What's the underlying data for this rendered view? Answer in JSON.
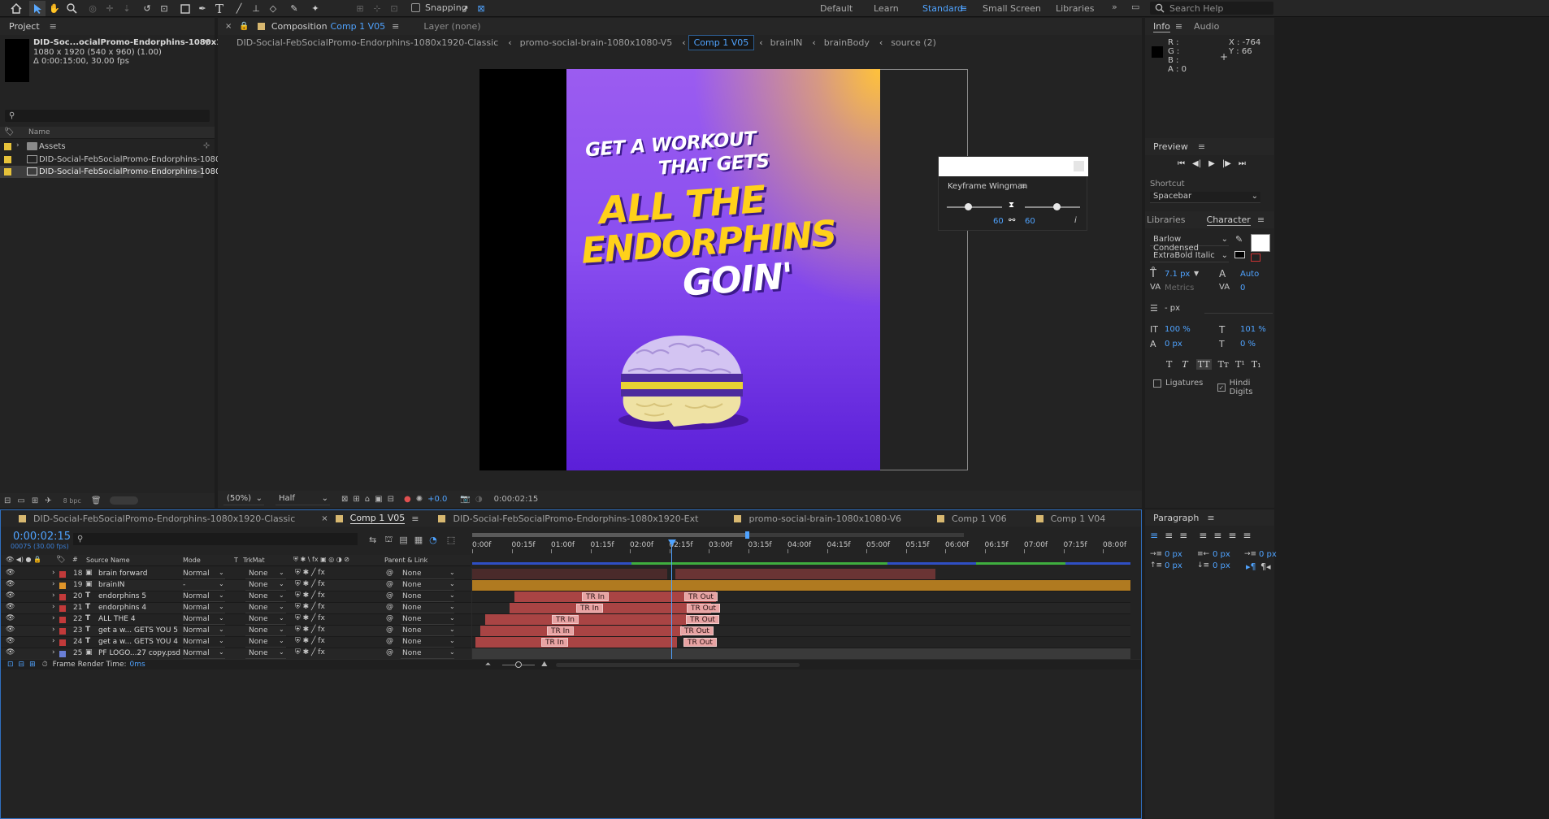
{
  "workspaces": [
    "Default",
    "Learn",
    "Standard",
    "Small Screen",
    "Libraries"
  ],
  "active_workspace": "Standard",
  "toolbar": {
    "snapping": "Snapping",
    "search_placeholder": "Search Help"
  },
  "project": {
    "title": "Project",
    "comp_name": "DID-Soc...ocialPromo-Endorphins-1080x1920-Ext",
    "comp_size": "1080 x 1920  (540 x 960) (1.00)",
    "comp_duration": "Δ 0:00:15:00, 30.00 fps",
    "name_header": "Name",
    "items": [
      {
        "label": "Assets",
        "type": "folder"
      },
      {
        "label": "DID-Social-FebSocialPromo-Endorphins-1080x192",
        "type": "comp"
      },
      {
        "label": "DID-Social-FebSocialPromo-Endorphins-1080x1",
        "type": "comp",
        "selected": true
      }
    ],
    "bpc": "8 bpc"
  },
  "composition": {
    "prefix": "Composition",
    "name": "Comp 1 V05",
    "layer_tab": "Layer (none)",
    "breadcrumbs": [
      "DID-Social-FebSocialPromo-Endorphins-1080x1920-Classic",
      "promo-social-brain-1080x1080-V5",
      "Comp 1 V05",
      "brainIN",
      "brainBody",
      "source (2)"
    ],
    "active_crumb": "Comp 1 V05"
  },
  "artwork": {
    "line1": "GET A WORKOUT",
    "line2": "THAT GETS",
    "line3": "ALL THE",
    "line4": "ENDORPHINS",
    "line5": "GOIN'",
    "colors": {
      "bg_top": "#ffc23a",
      "bg_mid": "#9b5cf0",
      "bg_bottom": "#5b1fd8",
      "yellow": "#ffd11a",
      "white": "#ffffff"
    }
  },
  "viewer": {
    "zoom": "(50%)",
    "resolution": "Half",
    "exposure": "+0.0",
    "timecode": "0:00:02:15"
  },
  "keyframe_wingman": {
    "title": "Keyframe Wingman",
    "left_value": "60",
    "right_value": "60",
    "info_icon": "i"
  },
  "info": {
    "tab1": "Info",
    "tab2": "Audio",
    "r": "R :",
    "g": "G :",
    "b": "B :",
    "a": "A : 0",
    "x": "X : -764",
    "y": "Y : 66"
  },
  "preview": {
    "title": "Preview",
    "shortcut_label": "Shortcut",
    "shortcut_value": "Spacebar"
  },
  "character": {
    "tab_libraries": "Libraries",
    "tab_character": "Character",
    "font": "Barlow Condensed",
    "style": "ExtraBold Italic",
    "size": "7.1 px",
    "leading": "Auto",
    "kerning": "Metrics",
    "tracking": "0",
    "stroke": "- px",
    "vscale": "100 %",
    "hscale": "101 %",
    "baseline": "0 px",
    "tsume": "0 %",
    "ligatures": "Ligatures",
    "hindi": "Hindi Digits"
  },
  "paragraph": {
    "title": "Paragraph",
    "i1": "0 px",
    "i2": "0 px",
    "i3": "0 px",
    "i4": "0 px",
    "i5": "0 px"
  },
  "timeline": {
    "tabs": [
      "DID-Social-FebSocialPromo-Endorphins-1080x1920-Classic",
      "Comp 1 V05",
      "DID-Social-FebSocialPromo-Endorphins-1080x1920-Ext",
      "promo-social-brain-1080x1080-V6",
      "Comp 1 V06",
      "Comp 1 V04"
    ],
    "active_tab": "Comp 1 V05",
    "timecode": "0:00:02:15",
    "frame_info": "00075 (30.00 fps)",
    "ruler": [
      "0:00f",
      "00:15f",
      "01:00f",
      "01:15f",
      "02:00f",
      "02:15f",
      "03:00f",
      "03:15f",
      "04:00f",
      "04:15f",
      "05:00f",
      "05:15f",
      "06:00f",
      "06:15f",
      "07:00f",
      "07:15f",
      "08:00f"
    ],
    "columns": {
      "source": "Source Name",
      "mode": "Mode",
      "t": "T",
      "trkmat": "TrkMat",
      "parent": "Parent & Link"
    },
    "layers": [
      {
        "num": "18",
        "name": "brain forward",
        "type": "img",
        "color": "#c23a3a",
        "mode": "Normal",
        "trkmat": "None",
        "parent": "None"
      },
      {
        "num": "19",
        "name": "brainIN",
        "type": "img",
        "color": "#e0952a",
        "mode": "-",
        "trkmat": "None",
        "parent": "None"
      },
      {
        "num": "20",
        "name": "endorphins 5",
        "type": "T",
        "color": "#c23a3a",
        "mode": "Normal",
        "trkmat": "None",
        "parent": "None"
      },
      {
        "num": "21",
        "name": "endorphins 4",
        "type": "T",
        "color": "#c23a3a",
        "mode": "Normal",
        "trkmat": "None",
        "parent": "None"
      },
      {
        "num": "22",
        "name": "ALL THE 4",
        "type": "T",
        "color": "#c23a3a",
        "mode": "Normal",
        "trkmat": "None",
        "parent": "None"
      },
      {
        "num": "23",
        "name": "get a w... GETS YOU  5",
        "type": "T",
        "color": "#c23a3a",
        "mode": "Normal",
        "trkmat": "None",
        "parent": "None"
      },
      {
        "num": "24",
        "name": "get a w... GETS YOU  4",
        "type": "T",
        "color": "#c23a3a",
        "mode": "Normal",
        "trkmat": "None",
        "parent": "None"
      },
      {
        "num": "25",
        "name": "PF LOGO...27 copy.psd",
        "type": "img",
        "color": "#6a7fd6",
        "mode": "Normal",
        "trkmat": "None",
        "parent": "None"
      }
    ],
    "tr_in": "TR In",
    "tr_out": "TR Out",
    "render_label": "Frame Render Time:",
    "render_value": "0ms"
  }
}
